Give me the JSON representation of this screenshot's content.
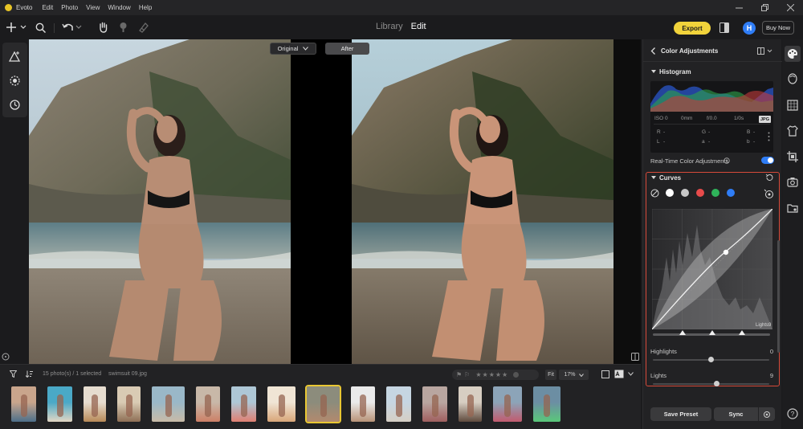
{
  "app": {
    "name": "Evoto",
    "menu": [
      "Edit",
      "Photo",
      "View",
      "Window",
      "Help"
    ]
  },
  "toolbar": {
    "tabs": [
      {
        "label": "Library",
        "active": false
      },
      {
        "label": "Edit",
        "active": true
      }
    ],
    "export_label": "Export",
    "avatar_initial": "H",
    "buy_label": "Buy Now",
    "accent_color": "#f1d33b"
  },
  "canvas": {
    "original_select": "Original",
    "after_label": "After"
  },
  "filmstrip": {
    "photo_count": "15 photo(s) / 1 selected",
    "filename": "swimsuit 09.jpg",
    "fit_label": "Fit",
    "zoom": "17%",
    "selected_index": 8,
    "thumbs": [
      {
        "colors": [
          "#c9a58c",
          "#4d6f8a"
        ]
      },
      {
        "colors": [
          "#4aa9c7",
          "#e3d7c4"
        ]
      },
      {
        "colors": [
          "#e6dccf",
          "#b88a58"
        ]
      },
      {
        "colors": [
          "#d9cbb4",
          "#8e6f55"
        ]
      },
      {
        "colors": [
          "#9ab8c8",
          "#c9bba7"
        ]
      },
      {
        "colors": [
          "#c8b8a8",
          "#cc7f66"
        ]
      },
      {
        "colors": [
          "#aec7d6",
          "#e07f72"
        ]
      },
      {
        "colors": [
          "#f0e5d5",
          "#d9a679"
        ]
      },
      {
        "colors": [
          "#8c8c7c",
          "#b28a6e"
        ]
      },
      {
        "colors": [
          "#eaeaea",
          "#b89378"
        ]
      },
      {
        "colors": [
          "#c6d6e2",
          "#d6cfc4"
        ]
      },
      {
        "colors": [
          "#b9a6a0",
          "#a05f5f"
        ]
      },
      {
        "colors": [
          "#d7cec2",
          "#5f4a3d"
        ]
      },
      {
        "colors": [
          "#8ca4b8",
          "#c25a6e"
        ]
      },
      {
        "colors": [
          "#6c8ea3",
          "#5ac87a"
        ]
      }
    ]
  },
  "panel": {
    "title": "Color Adjustments",
    "histogram": {
      "title": "Histogram",
      "exif": [
        "ISO 0",
        "0mm",
        "f/0.0",
        "1/0s"
      ],
      "format": "JPG",
      "rgb": [
        "R",
        "G",
        "B"
      ],
      "lab": [
        "L",
        "a",
        "b"
      ],
      "dash": "-"
    },
    "realtime": {
      "label": "Real-Time Color Adjustments",
      "enabled": true
    },
    "curves": {
      "title": "Curves",
      "channels": [
        "#ffffff",
        "#c8c8c8",
        "#e84b4b",
        "#2fb35a",
        "#2f7df6"
      ],
      "tag": "Lights9",
      "highlight_color": "#d84a3a"
    },
    "adjustments": [
      {
        "label": "Highlights",
        "value": "0",
        "level": 0.5
      },
      {
        "label": "Lights",
        "value": "9",
        "level": 0.55
      }
    ],
    "save_preset_label": "Save Preset",
    "sync_label": "Sync"
  },
  "help_label": "?"
}
